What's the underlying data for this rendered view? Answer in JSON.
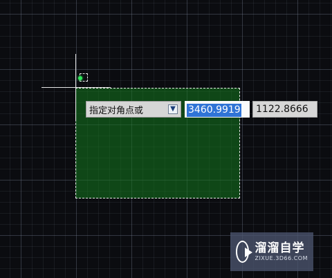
{
  "command": {
    "prompt_label": "指定对角点或",
    "x_value": "3460.9919",
    "y_value": "1122.8666"
  },
  "watermark": {
    "title": "溜溜自学",
    "url": "ZIXUE.3D66.COM"
  },
  "colors": {
    "canvas_background": "#0b0c10",
    "selection_fill": "#147a1e",
    "grip": "#2ee85a",
    "input_highlight": "#2f74d6"
  },
  "icons": {
    "prompt_dropdown": "down-arrow-icon",
    "watermark_logo": "play-logo-icon"
  }
}
